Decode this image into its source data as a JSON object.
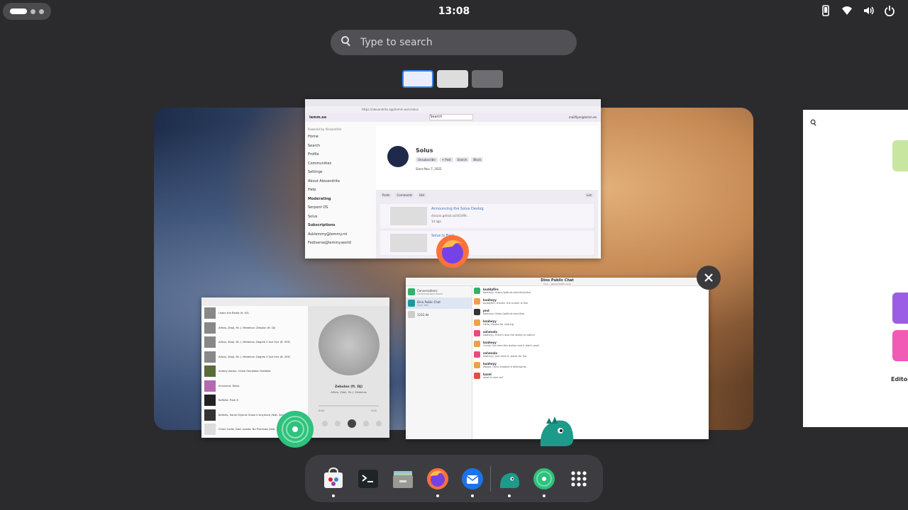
{
  "topbar": {
    "clock": "13:08",
    "tray_icons": [
      "phone-icon",
      "wifi-icon",
      "volume-icon",
      "power-icon"
    ]
  },
  "search": {
    "placeholder": "Type to search"
  },
  "workspaces": [
    "workspace-1",
    "workspace-2",
    "workspace-3"
  ],
  "lemmy": {
    "url": "https://alexandrite.app/lemm.ee/c/solus",
    "site": "lemm.ee",
    "powered": "Powered by Alexandrite",
    "user": "mailflyer@lemm.ee",
    "search_placeholder": "Search",
    "nav": [
      "Home",
      "Search",
      "Profile",
      "Communities",
      "Settings",
      "About Alexandrite",
      "Help"
    ],
    "moderating_label": "Moderating",
    "moderating": [
      "Serpent OS",
      "Solus"
    ],
    "subscriptions_label": "Subscriptions",
    "subscriptions": [
      "Asklemmy@lemmy.ml",
      "Fediverse@lemmy.world"
    ],
    "community": "Solus",
    "buttons": [
      "Unsubscribe",
      "+ Post",
      "Search",
      "Block"
    ],
    "since": "Since Nov 7, 2022",
    "tabs": [
      "Posts",
      "Comments"
    ],
    "sort": "Hot",
    "view": "List",
    "posts": [
      {
        "title": "Announcing the Solus Devlog",
        "link": "discuss.getsol.us/d/1490...",
        "meta": "1d ago"
      },
      {
        "title": "Solus Is Back",
        "link": "",
        "meta": ""
      }
    ]
  },
  "chat": {
    "title": "Dino Public Chat",
    "subtitle": "Dino – Jabber/XMPP client",
    "rooms": [
      {
        "name": "Conversations",
        "desc": "Conversations Room"
      },
      {
        "name": "Dino Public Chat",
        "desc": "Dino Talk"
      },
      {
        "name": "1222.de",
        "desc": ""
      }
    ],
    "messages": [
      {
        "name": "buddyfire",
        "text": "Kaaheyy: https://github.com/dino/dino"
      },
      {
        "name": "kaaheyy",
        "text": "buddyfire: thanks, the screen is fine"
      },
      {
        "name": "pnd",
        "text": "Kaaheyy: https://github.com/dino"
      },
      {
        "name": "kaaheyy",
        "text": "Hello, thanks for sharing"
      },
      {
        "name": "salvmala",
        "text": "kaaheyy, there's also the ability to switch"
      },
      {
        "name": "kaaheyy",
        "text": "I think I've tried this before and it didn't work"
      },
      {
        "name": "salvmala",
        "text": "kaaheyy, just tried it, works for me"
      },
      {
        "name": "kaaheyy",
        "text": "Maybe I only enabled it afterwards"
      },
      {
        "name": "kazel",
        "text": "what is your os?"
      }
    ]
  },
  "music": {
    "tracks": [
      "Listen the Radio (ft. XX)",
      "Alfizio, Zitoji, Mr. J. Medeiros: Zebulon (ft. DJ)",
      "Alfizio, Zitoji, Mr. J. Medeiros: Degree 3 Got One (ft. VEE)",
      "Alfizio, Zitoji, Mr. J. Medeiros: Degree 3 Got One (ft. VEE)",
      "Andrey Azizov, Chloe Gembiew: Feelslike",
      "Annuland: Tokyo",
      "BoTalks: Push It",
      "BoTalks, Sarah Hyland: Know U Anymore (feat. Sarah Hyland)",
      "Chiari Cadle, Dani Loosto: No Promises (feat. Dani Loosto)"
    ],
    "now_title": "Zebulon (ft. DJ)",
    "now_artist": "Alfizio, Zitoji, Mr. J. Medeiros",
    "time_current": "0:00",
    "time_total": "3:25"
  },
  "close_button": "close-workspace",
  "next_workspace": {
    "label": "Editor"
  },
  "dock": [
    {
      "name": "software-center",
      "running": true
    },
    {
      "name": "terminal",
      "running": false
    },
    {
      "name": "files",
      "running": false
    },
    {
      "name": "firefox",
      "running": true
    },
    {
      "name": "thunderbird",
      "running": true
    },
    {
      "name": "dino",
      "running": true
    },
    {
      "name": "music",
      "running": true
    },
    {
      "name": "app-grid",
      "running": false
    }
  ],
  "colors": {
    "accent": "#3584e4",
    "dock": "#3d3d41",
    "panel": "#2b2b2e"
  }
}
